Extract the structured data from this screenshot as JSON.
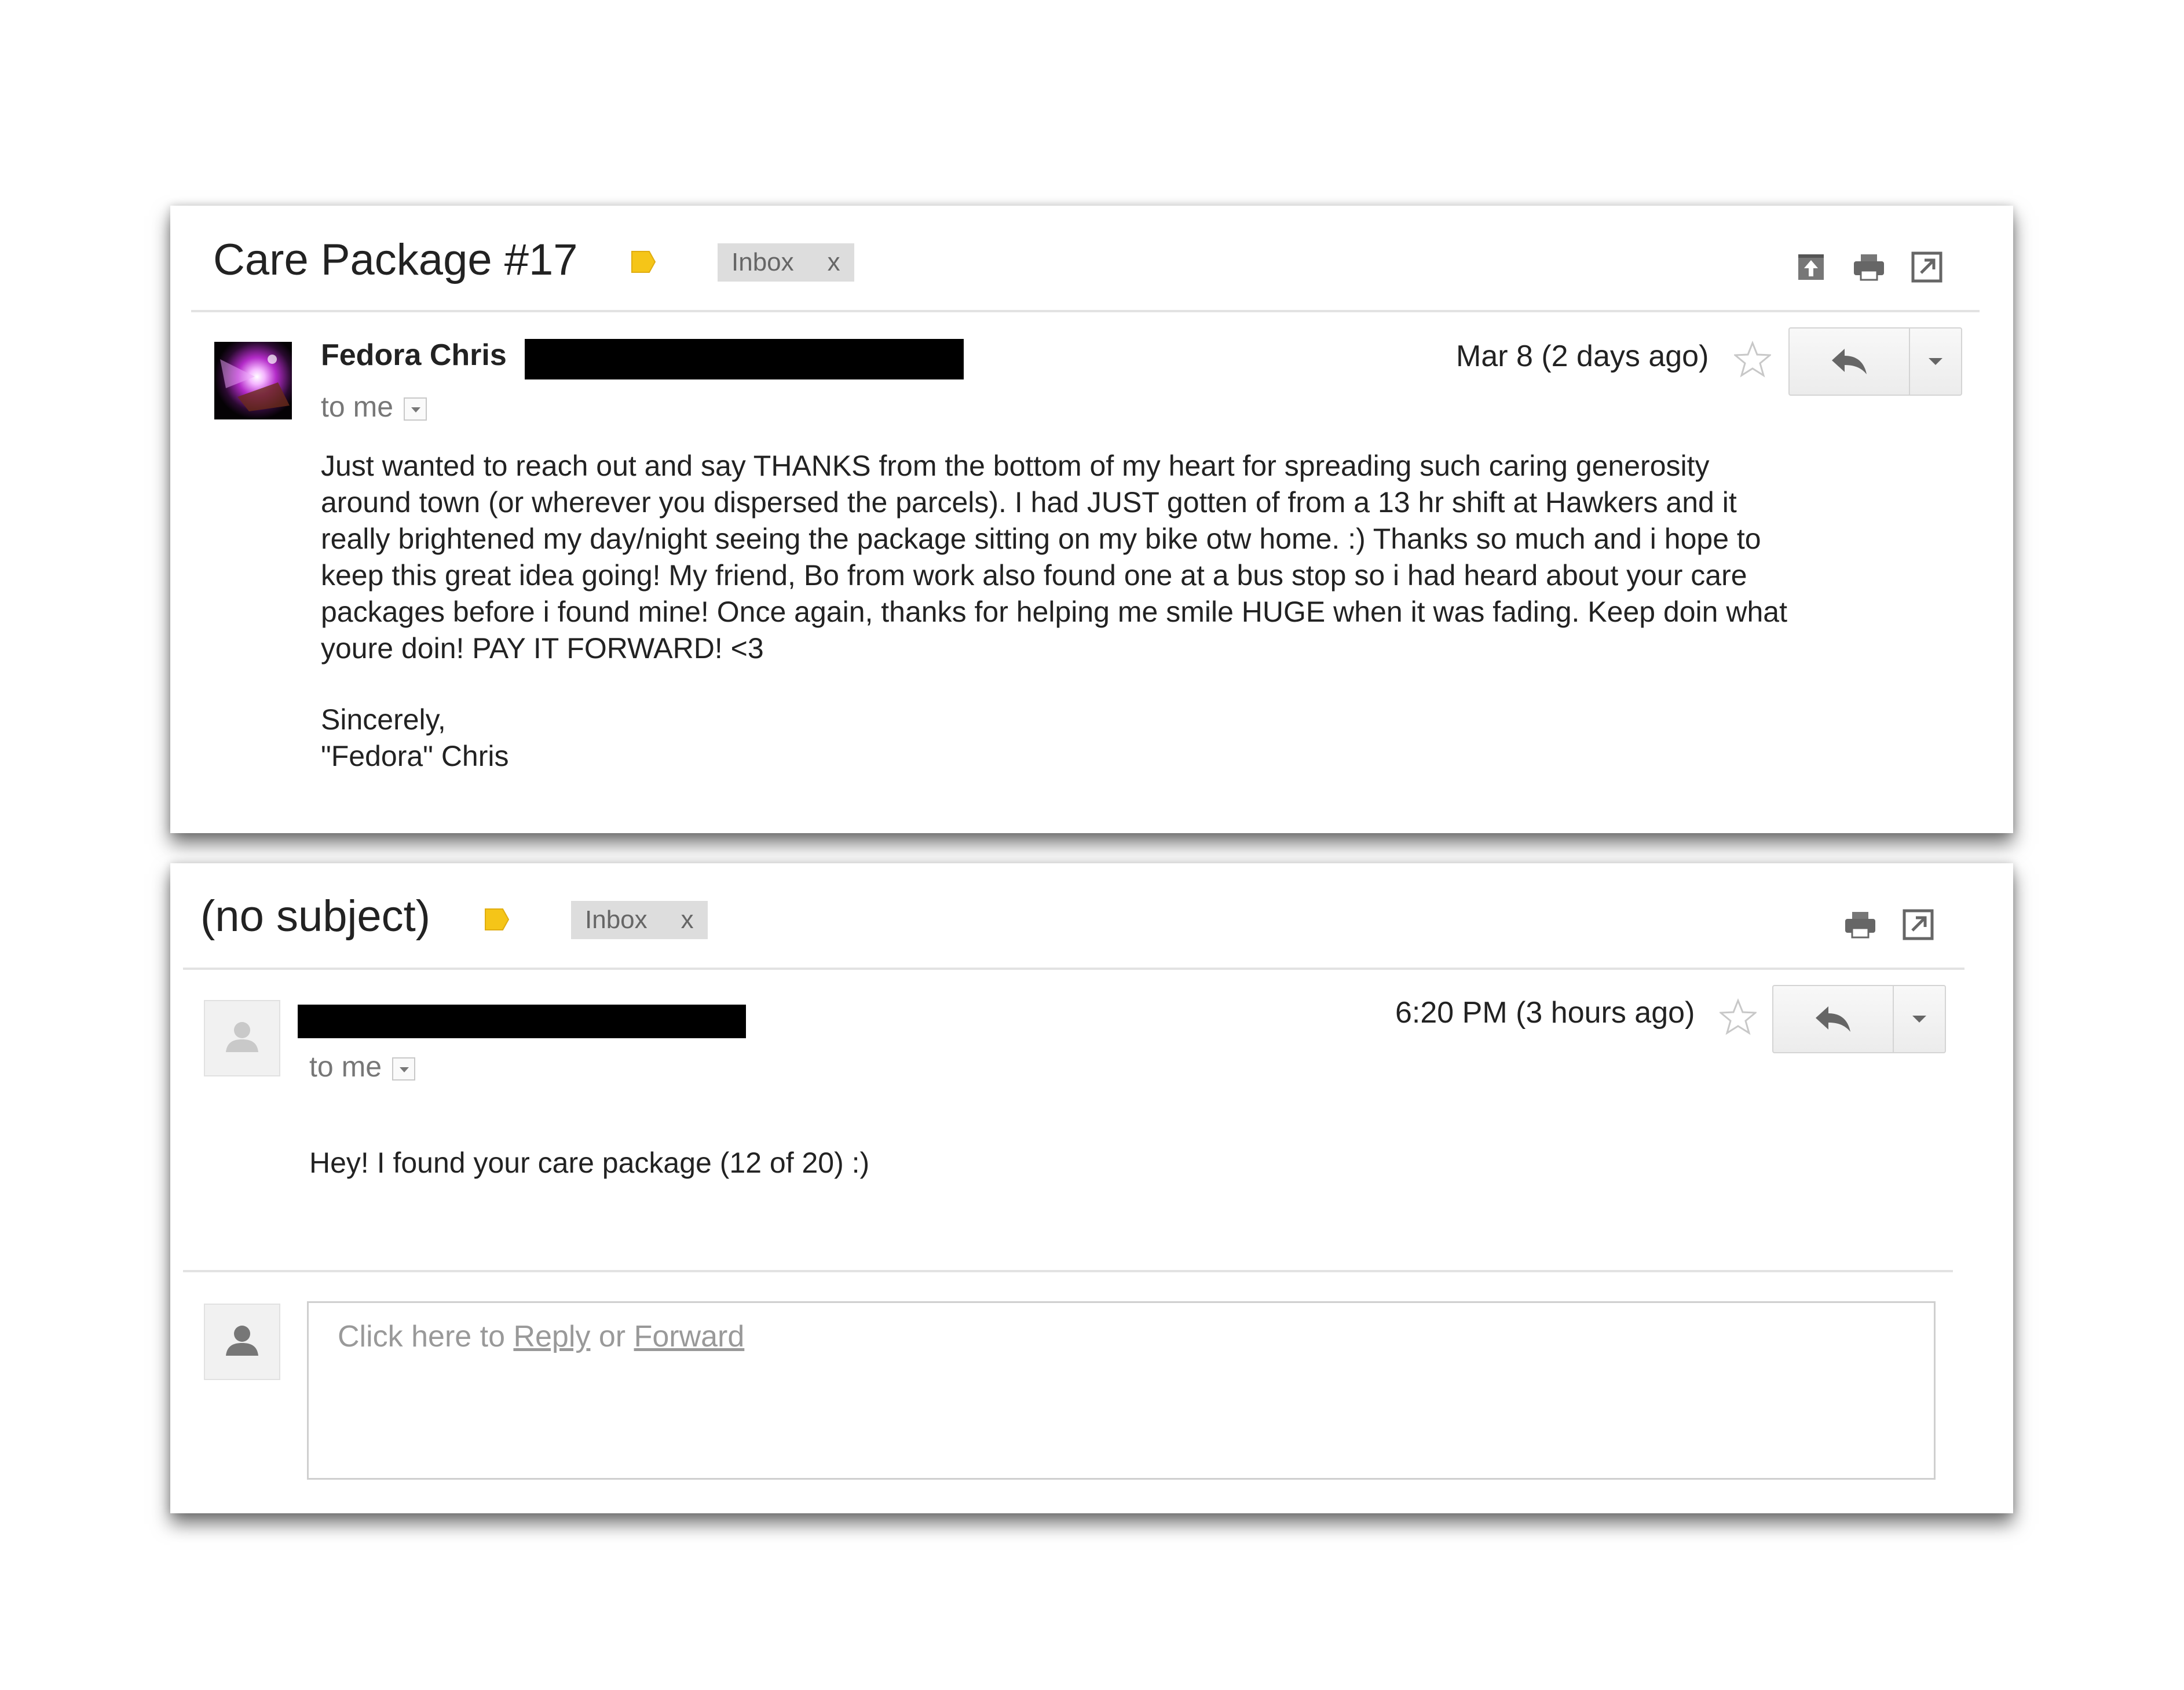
{
  "emails": [
    {
      "subject": "Care Package #17",
      "label_color": "#f5c518",
      "inbox_chip": {
        "label": "Inbox",
        "remove": "x"
      },
      "toolbar": [
        "archive-icon",
        "print-icon",
        "new-window-icon"
      ],
      "sender_name": "Fedora Chris",
      "recipient": "to me",
      "date": "Mar 8 (2 days ago)",
      "body": "Just wanted to reach out and say THANKS from the bottom of my heart for spreading such caring generosity\naround town (or wherever you dispersed the parcels). I had JUST gotten of from a 13 hr shift at Hawkers and it\nreally brightened my day/night seeing the package sitting on my bike otw home. :) Thanks so much and i hope to\nkeep this great idea going! My friend, Bo from work also found one at a bus stop so i had heard about your care\npackages before i found mine! Once again, thanks for helping me smile HUGE when it was fading. Keep doin what\nyoure doin! PAY IT FORWARD! <3",
      "signoff": "Sincerely,\n\"Fedora\" Chris"
    },
    {
      "subject": "(no subject)",
      "label_color": "#f5c518",
      "inbox_chip": {
        "label": "Inbox",
        "remove": "x"
      },
      "toolbar": [
        "print-icon",
        "new-window-icon"
      ],
      "recipient": "to me",
      "date": "6:20 PM (3 hours ago)",
      "body": "Hey! I found your care package (12 of 20) :)",
      "reply_prompt": {
        "prefix": "Click here to",
        "reply": "Reply",
        "or": "or",
        "forward": "Forward"
      }
    }
  ]
}
